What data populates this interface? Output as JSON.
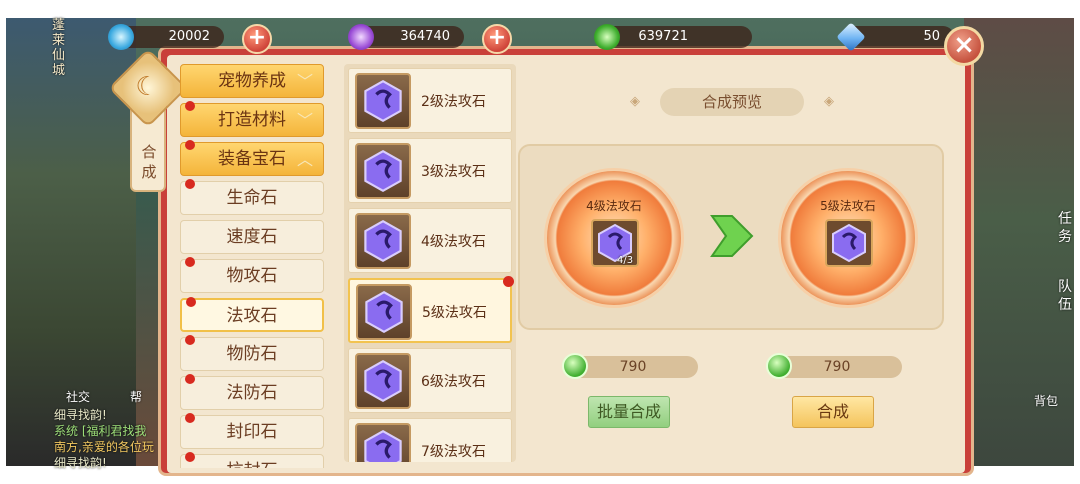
{
  "currencies": [
    {
      "icon": "blue-gem-icon",
      "value": "20002",
      "color": "#3aa9e0"
    },
    {
      "icon": "purple-orb-icon",
      "value": "364740",
      "color": "#9a4cd6"
    },
    {
      "icon": "green-coin-icon",
      "value": "639721",
      "color": "#3fae2e"
    },
    {
      "icon": "diamond-icon",
      "value": "50",
      "color": "#6fb4f3"
    }
  ],
  "side_tab": {
    "label": "合\n成"
  },
  "world_left": {
    "city_label": "蓬\n莱\n仙\n城",
    "social": "社交",
    "help": "帮",
    "chat": [
      "细寻找韵!",
      "系统 [福利君找我",
      "南方,亲爱的各位玩",
      "细寻找韵!"
    ]
  },
  "world_right": {
    "task": "任\n务",
    "team": "队\n伍",
    "bag": "背包"
  },
  "categories": [
    {
      "label": "宠物养成",
      "type": "parent",
      "dot": false
    },
    {
      "label": "打造材料",
      "type": "parent",
      "dot": true
    },
    {
      "label": "装备宝石",
      "type": "parent-open",
      "dot": true
    },
    {
      "label": "生命石",
      "type": "child",
      "dot": true
    },
    {
      "label": "速度石",
      "type": "child",
      "dot": false
    },
    {
      "label": "物攻石",
      "type": "child",
      "dot": true
    },
    {
      "label": "法攻石",
      "type": "child-selected",
      "dot": true
    },
    {
      "label": "物防石",
      "type": "child",
      "dot": true
    },
    {
      "label": "法防石",
      "type": "child",
      "dot": true
    },
    {
      "label": "封印石",
      "type": "child",
      "dot": true
    },
    {
      "label": "抗封石",
      "type": "child",
      "dot": true
    }
  ],
  "gems": [
    {
      "label": "2级法攻石",
      "selected": false,
      "dot": false
    },
    {
      "label": "3级法攻石",
      "selected": false,
      "dot": false
    },
    {
      "label": "4级法攻石",
      "selected": false,
      "dot": false
    },
    {
      "label": "5级法攻石",
      "selected": true,
      "dot": true
    },
    {
      "label": "6级法攻石",
      "selected": false,
      "dot": false
    },
    {
      "label": "7级法攻石",
      "selected": false,
      "dot": false
    }
  ],
  "preview": {
    "title": "合成预览",
    "source": {
      "name": "4级法攻石",
      "count": "4/3"
    },
    "target": {
      "name": "5级法攻石"
    }
  },
  "costs": {
    "batch": "790",
    "single": "790"
  },
  "buttons": {
    "batch": "批量合成",
    "merge": "合成"
  }
}
